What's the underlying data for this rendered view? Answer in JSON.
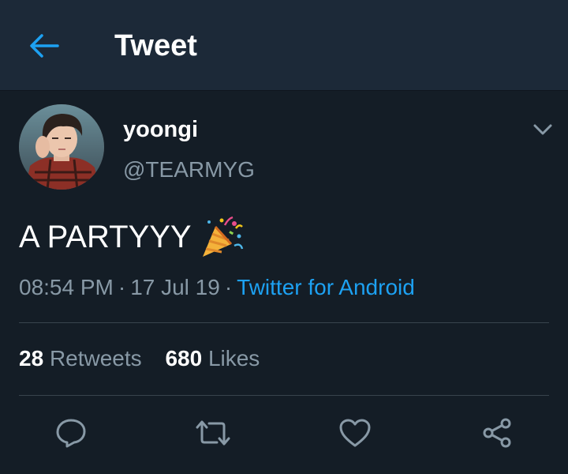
{
  "header": {
    "title": "Tweet",
    "back_icon": "arrow-left-icon",
    "accent_color": "#1da1f2"
  },
  "tweet": {
    "display_name": "yoongi",
    "handle": "@TEARMYG",
    "text": "A PARTYYY",
    "emoji_icon": "party-popper-icon",
    "time": "08:54 PM",
    "date": "17 Jul 19",
    "separator": "·",
    "source": "Twitter for Android"
  },
  "stats": {
    "retweets_count": "28",
    "retweets_label": "Retweets",
    "likes_count": "680",
    "likes_label": "Likes"
  },
  "actions": [
    {
      "icon": "reply-icon"
    },
    {
      "icon": "retweet-icon"
    },
    {
      "icon": "heart-icon"
    },
    {
      "icon": "share-icon"
    }
  ],
  "colors": {
    "background": "#141d26",
    "header_background": "#1c2938",
    "secondary_text": "#8899a6",
    "link": "#1da1f2",
    "divider": "#38444d"
  }
}
